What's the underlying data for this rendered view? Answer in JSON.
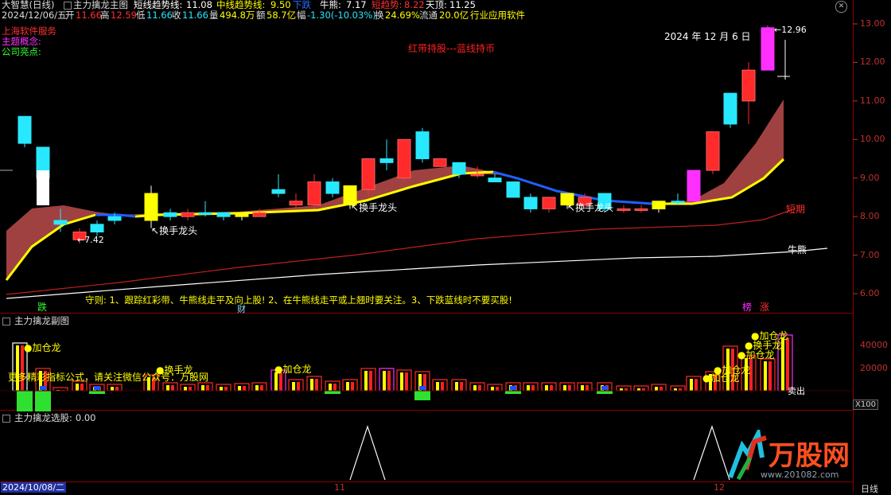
{
  "topbar": {
    "app": "大智慧(日线)",
    "main_chart": "主力擒龙主图",
    "short_label": "短线趋势线:",
    "short_value": "11.08",
    "mid_label": "中线趋势线:",
    "mid_value": "9.50",
    "mid_status": "下跌",
    "bear_label": "牛熊:",
    "bear_value": "7.17",
    "short_trend_label": "短趋势:",
    "short_trend_value": "8.22",
    "top_label": "天顶:",
    "top_value": "11.25"
  },
  "infobar": {
    "date": "2024/12/06/五",
    "open_label": "开",
    "open": "11.66",
    "high_label": "高",
    "high": "12.59",
    "low_label": "低",
    "low": "11.66",
    "close_label": "收",
    "close": "11.66",
    "vol_label": "量",
    "vol": "494.8万",
    "amt_label": "额",
    "amt": "58.7亿",
    "chg_label": "幅",
    "chg": "-1.30(-10.03%)",
    "turn_label": "换",
    "turn": "24.69%",
    "float_label": "流通",
    "float": "20.0亿",
    "industry": "行业应用软件"
  },
  "main_chart": {
    "stock_info": [
      "上海软件服务",
      "主题概念:",
      "公司亮点:"
    ],
    "date_label": "2024 年 12 月 6 日",
    "high_mark": "12.96",
    "low_mark": "7.42",
    "strategy": "红带持股---蓝线持币",
    "rule_text": "守则: 1、跟踪红彩带、牛熊线走平及向上股! 2、在牛熊线走平或上翘时要关注。3、下跌蓝线时不要买股!",
    "annotations": [
      "换手龙头",
      "换手龙头",
      "换手龙头"
    ],
    "line_labels": {
      "short": "短期",
      "bull": "牛熊"
    },
    "bottom_marks": {
      "drop": "跌",
      "wealth": "财",
      "rank": "榜",
      "rise": "涨"
    },
    "y_ticks": [
      "13.00",
      "12.00",
      "11.00",
      "10.00",
      "9.00",
      "8.00",
      "7.00",
      "6.00"
    ]
  },
  "sub_chart": {
    "title": "主力擒龙副图",
    "ad_text": "更多精彩指标公式，请关注微信公众号：万股网",
    "labels": [
      "加仓龙",
      "换手龙",
      "加仓龙",
      "加仓龙",
      "加仓龙",
      "加仓龙",
      "换手龙",
      "加仓龙"
    ],
    "sell": "卖出",
    "y_ticks": [
      "40000",
      "20000"
    ],
    "unit": "X100"
  },
  "select_chart": {
    "title": "主力擒龙选股",
    "value": "0.00"
  },
  "footer": {
    "date": "2024/10/08/二",
    "months": [
      "11",
      "12"
    ],
    "period": "日线"
  },
  "watermark": {
    "brand": "万股网",
    "url": "www.201082.com"
  },
  "colors": {
    "up": "#ff2a2a",
    "down": "#28e8ff",
    "yellow": "#ffff00",
    "magenta": "#ff30ff",
    "blue": "#2060ff",
    "band": "#b04848"
  },
  "chart_data": {
    "type": "candlestick",
    "candles": [
      {
        "o": 9.9,
        "c": 10.6,
        "h": 10.6,
        "l": 9.8,
        "dir": "down"
      },
      {
        "o": 9.8,
        "c": 9.0,
        "h": 9.8,
        "l": 8.9,
        "dir": "down"
      },
      {
        "o": 7.9,
        "c": 7.8,
        "h": 8.2,
        "l": 7.6,
        "dir": "down"
      },
      {
        "o": 7.6,
        "c": 7.4,
        "h": 7.7,
        "l": 7.3,
        "dir": "up"
      },
      {
        "o": 7.8,
        "c": 7.6,
        "h": 7.9,
        "l": 7.5,
        "dir": "down"
      },
      {
        "o": 8.0,
        "c": 7.9,
        "h": 8.1,
        "l": 7.8,
        "dir": "down"
      },
      {
        "o": 8.6,
        "c": 7.9,
        "h": 8.8,
        "l": 7.7,
        "dir": "yellow"
      },
      {
        "o": 8.1,
        "c": 8.0,
        "h": 8.2,
        "l": 7.9,
        "dir": "down"
      },
      {
        "o": 8.0,
        "c": 8.1,
        "h": 8.2,
        "l": 7.9,
        "dir": "up"
      },
      {
        "o": 8.1,
        "c": 8.1,
        "h": 8.4,
        "l": 8.0,
        "dir": "down"
      },
      {
        "o": 8.1,
        "c": 8.0,
        "h": 8.1,
        "l": 7.9,
        "dir": "down"
      },
      {
        "o": 8.0,
        "c": 8.1,
        "h": 8.1,
        "l": 7.9,
        "dir": "yellow"
      },
      {
        "o": 8.0,
        "c": 8.1,
        "h": 8.2,
        "l": 8.0,
        "dir": "up"
      },
      {
        "o": 8.6,
        "c": 8.7,
        "h": 9.1,
        "l": 8.5,
        "dir": "down"
      },
      {
        "o": 8.3,
        "c": 8.4,
        "h": 8.6,
        "l": 8.2,
        "dir": "up"
      },
      {
        "o": 8.3,
        "c": 8.9,
        "h": 9.1,
        "l": 8.2,
        "dir": "up"
      },
      {
        "o": 8.9,
        "c": 8.6,
        "h": 9.0,
        "l": 8.5,
        "dir": "down"
      },
      {
        "o": 8.3,
        "c": 8.8,
        "h": 8.8,
        "l": 8.2,
        "dir": "yellow"
      },
      {
        "o": 8.7,
        "c": 9.5,
        "h": 9.5,
        "l": 8.5,
        "dir": "up"
      },
      {
        "o": 9.5,
        "c": 9.4,
        "h": 10.0,
        "l": 9.2,
        "dir": "down"
      },
      {
        "o": 9.0,
        "c": 10.0,
        "h": 10.0,
        "l": 8.9,
        "dir": "up"
      },
      {
        "o": 10.2,
        "c": 9.5,
        "h": 10.3,
        "l": 9.4,
        "dir": "down"
      },
      {
        "o": 9.5,
        "c": 9.3,
        "h": 9.5,
        "l": 9.3,
        "dir": "up"
      },
      {
        "o": 9.4,
        "c": 9.1,
        "h": 9.4,
        "l": 9.0,
        "dir": "down"
      },
      {
        "o": 9.1,
        "c": 9.1,
        "h": 9.3,
        "l": 9.0,
        "dir": "up"
      },
      {
        "o": 9.0,
        "c": 8.9,
        "h": 9.1,
        "l": 8.9,
        "dir": "down"
      },
      {
        "o": 8.9,
        "c": 8.5,
        "h": 8.9,
        "l": 8.5,
        "dir": "down"
      },
      {
        "o": 8.5,
        "c": 8.2,
        "h": 8.6,
        "l": 8.1,
        "dir": "down"
      },
      {
        "o": 8.2,
        "c": 8.5,
        "h": 8.5,
        "l": 8.1,
        "dir": "up"
      },
      {
        "o": 8.6,
        "c": 8.3,
        "h": 8.6,
        "l": 8.2,
        "dir": "yellow"
      },
      {
        "o": 8.3,
        "c": 8.5,
        "h": 8.6,
        "l": 8.2,
        "dir": "up"
      },
      {
        "o": 8.6,
        "c": 8.2,
        "h": 8.6,
        "l": 8.1,
        "dir": "down"
      },
      {
        "o": 8.2,
        "c": 8.2,
        "h": 8.3,
        "l": 8.1,
        "dir": "up"
      },
      {
        "o": 8.2,
        "c": 8.2,
        "h": 8.3,
        "l": 8.1,
        "dir": "up"
      },
      {
        "o": 8.2,
        "c": 8.4,
        "h": 8.4,
        "l": 8.1,
        "dir": "yellow"
      },
      {
        "o": 8.4,
        "c": 8.4,
        "h": 8.6,
        "l": 8.3,
        "dir": "down"
      },
      {
        "o": 8.4,
        "c": 9.2,
        "h": 9.2,
        "l": 8.4,
        "dir": "magenta"
      },
      {
        "o": 9.2,
        "c": 10.2,
        "h": 10.2,
        "l": 9.1,
        "dir": "up"
      },
      {
        "o": 10.4,
        "c": 11.2,
        "h": 11.2,
        "l": 10.3,
        "dir": "down"
      },
      {
        "o": 11.0,
        "c": 11.8,
        "h": 12.0,
        "l": 10.4,
        "dir": "up"
      },
      {
        "o": 11.8,
        "c": 12.9,
        "h": 12.96,
        "l": 12.0,
        "dir": "magenta"
      }
    ]
  }
}
